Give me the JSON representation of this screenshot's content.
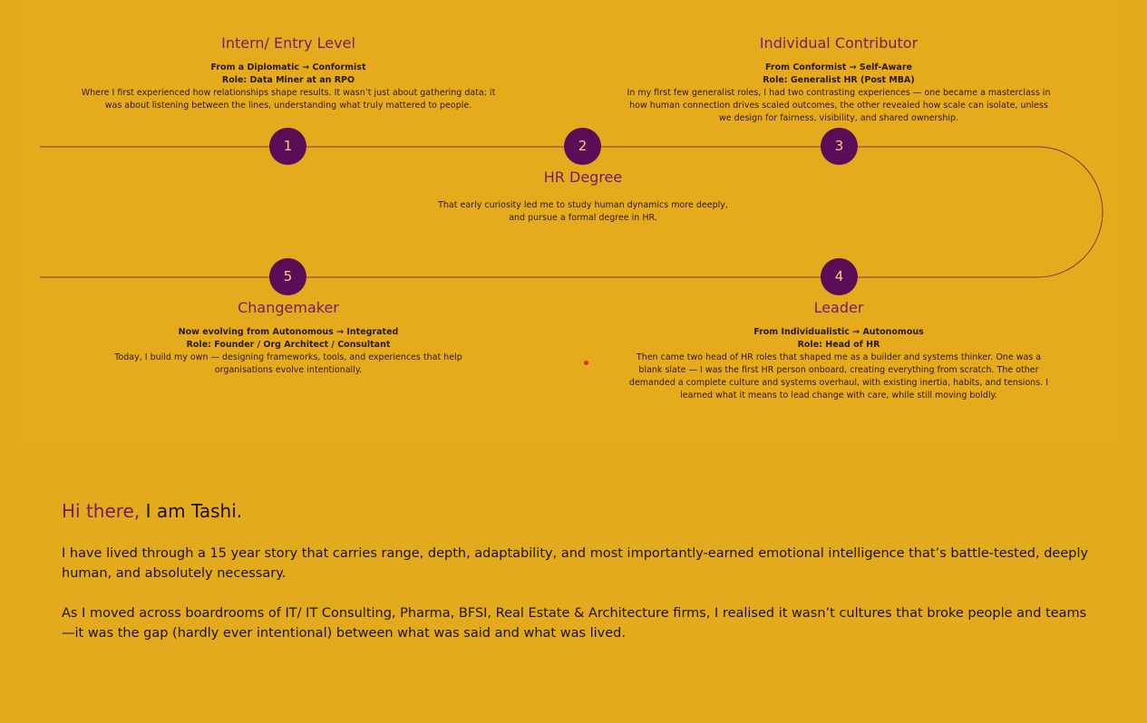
{
  "timeline": {
    "milestones": [
      {
        "number": "1",
        "title": "Intern/ Entry Level",
        "meta": [
          "From a Diplomatic → Conformist",
          "Role: Data Miner at an RPO"
        ],
        "desc": "Where I first experienced how relationships shape results. It wasn’t just about gathering data; it was about listening between the lines, understanding what truly mattered to people."
      },
      {
        "number": "2",
        "title": "HR Degree",
        "meta": [],
        "desc": "That early curiosity led me to study human dynamics more deeply, and pursue a formal degree in HR."
      },
      {
        "number": "3",
        "title": "Individual Contributor",
        "meta": [
          "From Conformist → Self-Aware",
          "Role: Generalist HR (Post MBA)"
        ],
        "desc": "In my first few generalist roles, I had two contrasting experiences — one became a masterclass in how human connection drives scaled outcomes, the other revealed how scale can isolate, unless we design for fairness, visibility, and shared ownership."
      },
      {
        "number": "4",
        "title": "Leader",
        "meta": [
          "From Individualistic → Autonomous",
          "Role: Head of HR"
        ],
        "desc": "Then came two head of HR roles that shaped me as a builder and systems thinker. One was a blank slate — I was the first HR person onboard, creating everything from scratch. The other demanded a complete culture and systems overhaul, with existing inertia, habits, and tensions. I learned what it means to lead change with care, while still moving boldly."
      },
      {
        "number": "5",
        "title": "Changemaker",
        "meta": [
          "Now evolving from Autonomous → Integrated",
          "Role: Founder / Org Architect / Consultant"
        ],
        "desc": "Today, I build my own — designing frameworks, tools, and experiences that help organisations evolve intentionally."
      }
    ]
  },
  "intro": {
    "greeting": "Hi there,",
    "name": " I am Tashi.",
    "paragraphs": [
      "I have lived through a 15 year story that carries range, depth, adaptability, and most importantly-earned emotional intelligence that’s battle-tested, deeply human, and absolutely necessary.",
      "As I moved across boardrooms of IT/ IT Consulting, Pharma, BFSI, Real Estate & Architecture firms, I realised it wasn’t cultures that broke people and teams—it was the gap (hardly ever intentional) between what was said and what was lived."
    ]
  },
  "colors": {
    "background": "#e3aa1e",
    "accent": "#7a1a5e",
    "node": "#5b0d58",
    "line": "#7a3a2a"
  }
}
